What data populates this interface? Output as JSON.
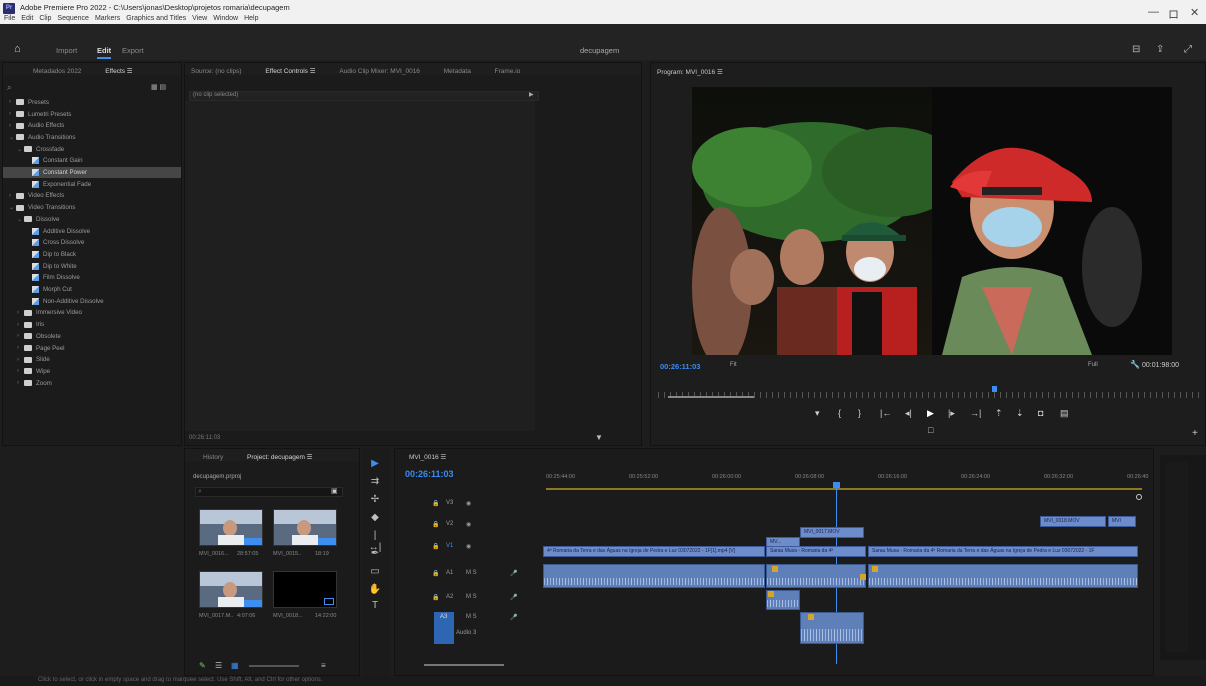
{
  "window": {
    "title": "Adobe Premiere Pro 2022 - C:\\Users\\jonas\\Desktop\\projetos romaria\\decupagem",
    "app_icon": "Pr",
    "menu": [
      "File",
      "Edit",
      "Clip",
      "Sequence",
      "Markers",
      "Graphics and Titles",
      "View",
      "Window",
      "Help"
    ],
    "controls": {
      "minimize": "—",
      "maximize": "ロ",
      "close": "✕"
    }
  },
  "workspace": {
    "home_icon": "home-icon",
    "tabs": [
      "Import",
      "Edit",
      "Export"
    ],
    "active": "Edit",
    "title": "decupagem"
  },
  "effects_panel": {
    "tabs": [
      "Metadados 2022",
      "Effects ☰"
    ],
    "search_placeholder": "",
    "items": [
      {
        "label": "Presets",
        "indent": 0,
        "type": "folder",
        "open": false
      },
      {
        "label": "Lumetri Presets",
        "indent": 0,
        "type": "folder",
        "open": false
      },
      {
        "label": "Audio Effects",
        "indent": 0,
        "type": "folder",
        "open": false
      },
      {
        "label": "Audio Transitions",
        "indent": 0,
        "type": "folder",
        "open": true
      },
      {
        "label": "Crossfade",
        "indent": 1,
        "type": "folder",
        "open": true
      },
      {
        "label": "Constant Gain",
        "indent": 2,
        "type": "fx"
      },
      {
        "label": "Constant Power",
        "indent": 2,
        "type": "fx",
        "selected": true
      },
      {
        "label": "Exponential Fade",
        "indent": 2,
        "type": "fx"
      },
      {
        "label": "Video Effects",
        "indent": 0,
        "type": "folder",
        "open": false
      },
      {
        "label": "Video Transitions",
        "indent": 0,
        "type": "folder",
        "open": true
      },
      {
        "label": "Dissolve",
        "indent": 1,
        "type": "folder",
        "open": true
      },
      {
        "label": "Additive Dissolve",
        "indent": 2,
        "type": "fx"
      },
      {
        "label": "Cross Dissolve",
        "indent": 2,
        "type": "fx"
      },
      {
        "label": "Dip to Black",
        "indent": 2,
        "type": "fx"
      },
      {
        "label": "Dip to White",
        "indent": 2,
        "type": "fx"
      },
      {
        "label": "Film Dissolve",
        "indent": 2,
        "type": "fx"
      },
      {
        "label": "Morph Cut",
        "indent": 2,
        "type": "fx"
      },
      {
        "label": "Non-Additive Dissolve",
        "indent": 2,
        "type": "fx"
      },
      {
        "label": "Immersive Video",
        "indent": 1,
        "type": "folder",
        "open": false
      },
      {
        "label": "Iris",
        "indent": 1,
        "type": "folder",
        "open": false
      },
      {
        "label": "Obsolete",
        "indent": 1,
        "type": "folder",
        "open": false
      },
      {
        "label": "Page Peel",
        "indent": 1,
        "type": "folder",
        "open": false
      },
      {
        "label": "Slide",
        "indent": 1,
        "type": "folder",
        "open": false
      },
      {
        "label": "Wipe",
        "indent": 1,
        "type": "folder",
        "open": false
      },
      {
        "label": "Zoom",
        "indent": 1,
        "type": "folder",
        "open": false
      }
    ]
  },
  "effect_controls": {
    "tabs": [
      "Source: (no clips)",
      "Effect Controls ☰",
      "Audio Clip Mixer: MVI_0016",
      "Metadata",
      "Frame.io"
    ],
    "no_clip": "(no clip selected)",
    "timecode": "00:26:11:03"
  },
  "program_monitor": {
    "label": "Program: MVI_0016 ☰",
    "timecode": "00:26:11:03",
    "fit": "Fit",
    "quality": "Full",
    "duration": "00:01:98:00"
  },
  "project_panel": {
    "tabs": [
      "History",
      "Project: decupagem ☰"
    ],
    "file": "decupagem.prproj",
    "clips": [
      {
        "name": "MVI_0016...",
        "duration": "28:57:05"
      },
      {
        "name": "MVI_0015..",
        "duration": "18:19"
      },
      {
        "name": "MVI_0017.M..",
        "duration": "4:07:06"
      },
      {
        "name": "MVI_0018...",
        "duration": "14:22:00"
      }
    ]
  },
  "timeline": {
    "seq_tab": "MVI_0016 ☰",
    "timecode": "00:26:11:03",
    "ruler": [
      "00:25:44:00",
      "00:25:52:00",
      "00:26:00:00",
      "00:26:08:00",
      "00:26:16:00",
      "00:26:24:00",
      "00:26:32:00",
      "00:26:40"
    ],
    "tracks": [
      "V3",
      "V2",
      "V1",
      "A1",
      "A2",
      "A3"
    ],
    "audio3_label": "Audio 3",
    "clips": {
      "v1_a": "4ª Romaria da Terra e das Águas na Igreja de Pedra e Luz 03072022 - 1F[1].mp4 [V]",
      "v1_b": "Sarau Musa - Romaria da 4ª",
      "v1_c": "Sarau Musa - Romaria da 4ª Romaria da Terra e das Águas na Igreja de Pedra e Luz 03072022 - 1F",
      "v2_a": "MVI_0017.MOV",
      "v2_b": "MV...",
      "v3_a": "MVI_0018.MOV",
      "v3_b": "MVI"
    }
  },
  "status": "Click to select, or click in empty space and drag to marquee select. Use Shift, Alt, and Ctrl for other options."
}
